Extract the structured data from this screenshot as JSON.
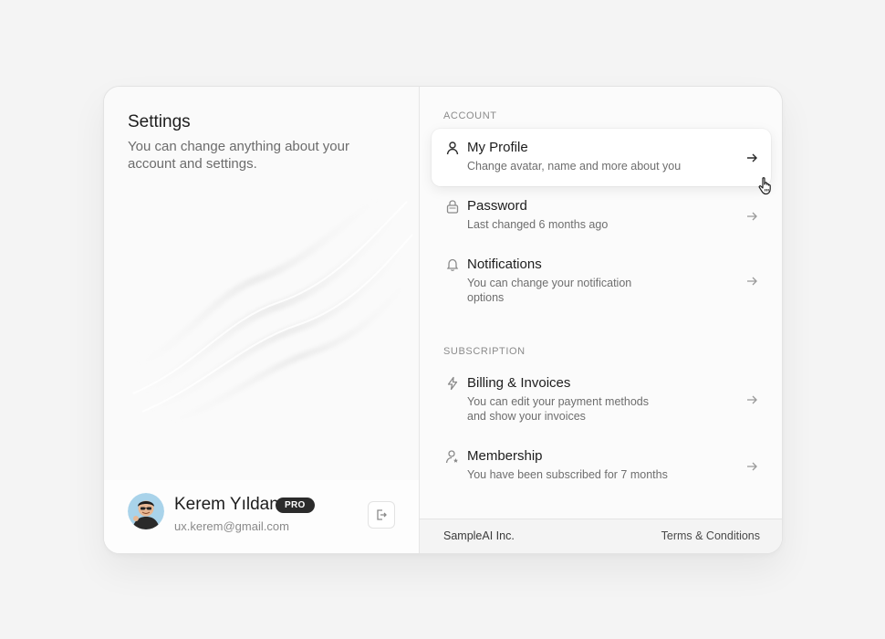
{
  "settings": {
    "title": "Settings",
    "description": "You can change anything about your account and settings."
  },
  "user": {
    "name": "Kerem Yıldan",
    "badge": "PRO",
    "email": "ux.kerem@gmail.com"
  },
  "sections": {
    "account_label": "ACCOUNT",
    "subscription_label": "SUBSCRIPTION"
  },
  "items": [
    {
      "title": "My Profile",
      "subtitle": "Change avatar, name and more about you",
      "icon": "user-icon"
    },
    {
      "title": "Password",
      "subtitle": "Last changed 6 months ago",
      "icon": "lock-icon"
    },
    {
      "title": "Notifications",
      "subtitle": "You can change your notification options",
      "icon": "bell-icon"
    },
    {
      "title": "Billing & Invoices",
      "subtitle": "You can edit your payment methods and show your invoices",
      "icon": "lightning-icon"
    },
    {
      "title": "Membership",
      "subtitle": "You have been subscribed for 7 months",
      "icon": "member-star-icon"
    }
  ],
  "footer": {
    "company": "SampleAI Inc.",
    "terms": "Terms & Conditions"
  },
  "colors": {
    "background": "#f4f4f4",
    "card": "#fbfbfb",
    "badge": "#2b2b2b"
  }
}
